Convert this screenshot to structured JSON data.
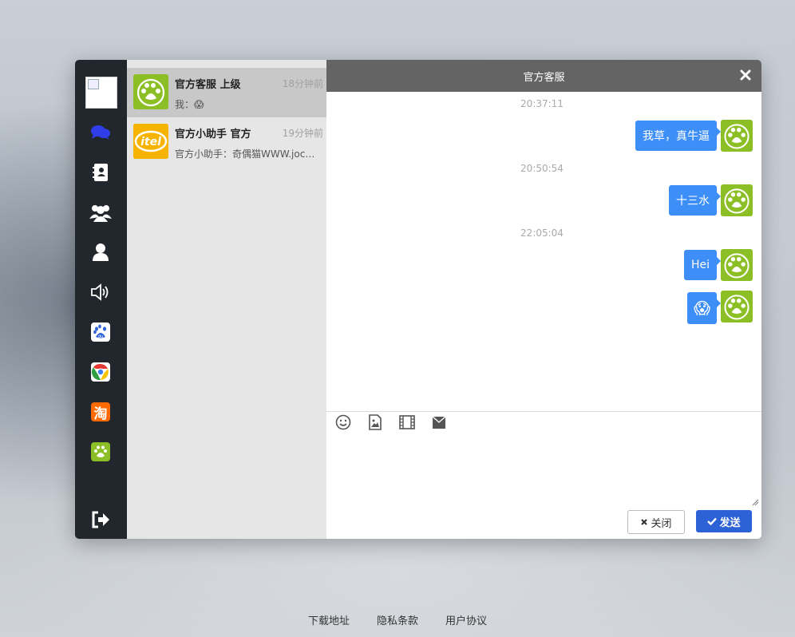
{
  "chat_title": "官方客服",
  "sidebar": {
    "icons": [
      "chat-icon",
      "contacts-icon",
      "groups-icon",
      "user-icon",
      "speaker-icon",
      "baidu-app-icon",
      "chrome-app-icon",
      "taobao-app-icon",
      "paw-app-icon"
    ],
    "logout_icon": "logout-icon",
    "taobao_char": "淘",
    "baidu_text": "du",
    "accent": "#2f3ee8"
  },
  "conversations": [
    {
      "name": "官方客服 上级",
      "time": "18分钟前",
      "preview_prefix": "我：",
      "preview_emoji": "😱",
      "active": true
    },
    {
      "name": "官方小助手 官方",
      "time": "19分钟前",
      "preview": "官方小助手：奇偶猫WWW.jocat.cn"
    }
  ],
  "itel_logo": "itel",
  "messages": [
    {
      "time": "20:37:11",
      "text": "我草，真牛逼"
    },
    {
      "time": "20:50:54",
      "text": "十三水"
    },
    {
      "time": "22:05:04",
      "text": "Hei"
    },
    {
      "emoji": "😱"
    }
  ],
  "toolbar_icons": [
    "emoji-icon",
    "image-icon",
    "video-icon",
    "gift-icon"
  ],
  "buttons": {
    "close": "关闭",
    "send": "发送"
  },
  "footer": [
    "下载地址",
    "隐私条款",
    "用户协议"
  ],
  "colors": {
    "bubble": "#3d8ef7",
    "send_button": "#2d62d6",
    "header": "#646464",
    "sidebar": "#22272d",
    "avatar_green": "#8cbf26"
  }
}
